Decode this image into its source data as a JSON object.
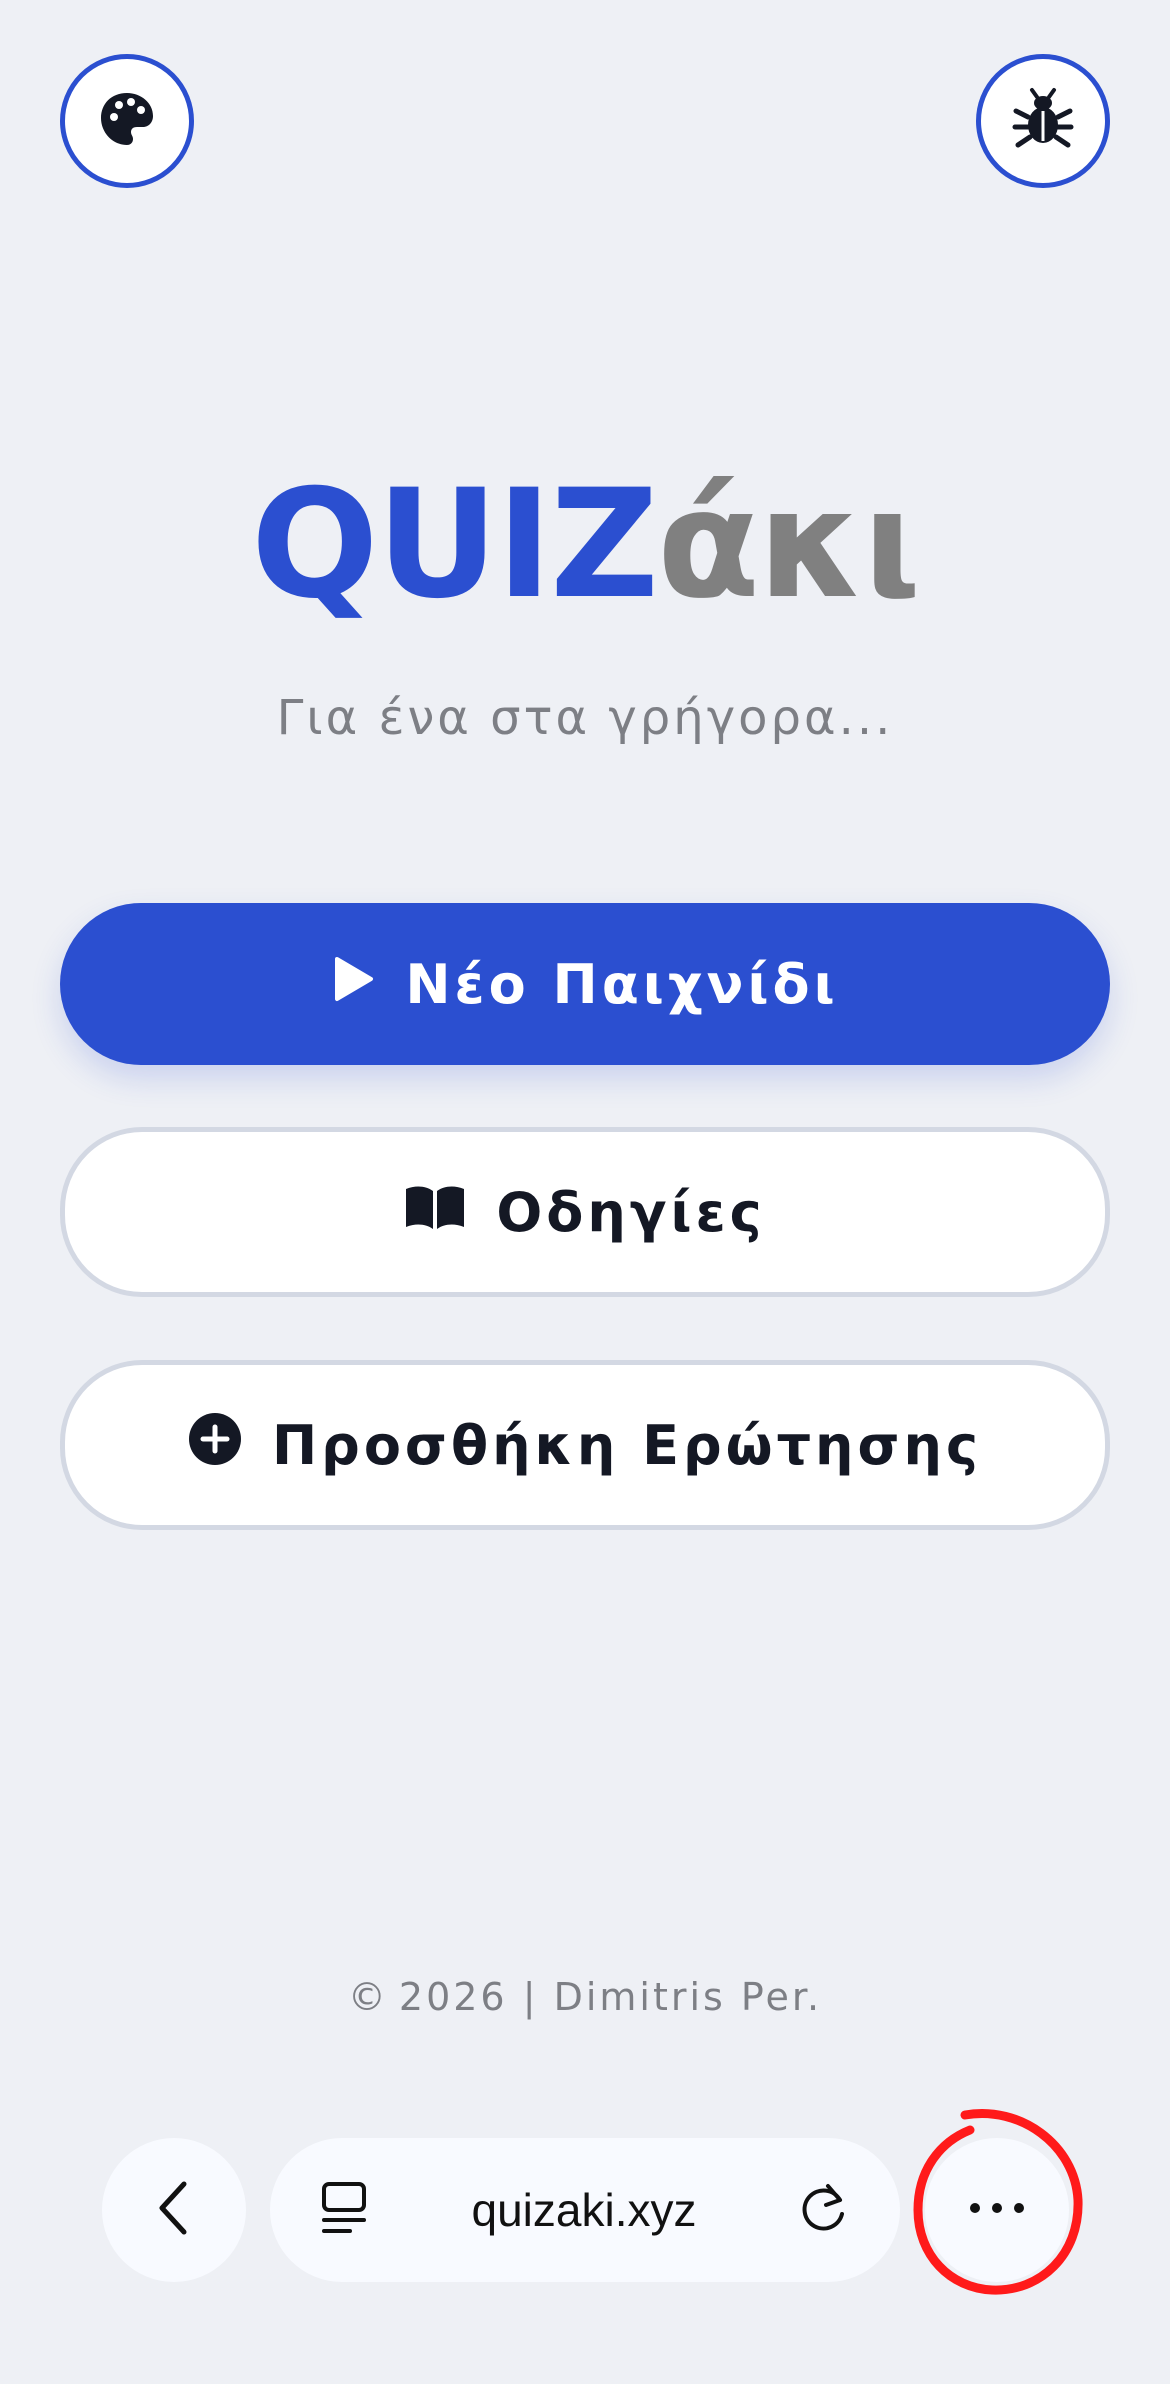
{
  "header": {
    "theme_icon": "palette-icon",
    "debug_icon": "bug-icon"
  },
  "logo": {
    "part1": "QUIZ",
    "part2": "άκι"
  },
  "subtitle": "Για ένα στα γρήγορα...",
  "buttons": {
    "new_game": "Νέο Παιχνίδι",
    "instructions": "Οδηγίες",
    "add_question": "Προσθήκη Ερώτησης"
  },
  "footer": {
    "symbol": "©",
    "text": "2026 | Dimitris Per."
  },
  "browser": {
    "url": "quizaki.xyz",
    "back_icon": "chevron-left-icon",
    "tab_icon": "tab-overview-icon",
    "reload_icon": "reload-icon",
    "more_icon": "more-horizontal-icon"
  },
  "colors": {
    "accent": "#2b4fd0",
    "background": "#eef0f5",
    "logo_gray": "#808080",
    "annotation": "#ff1a1a"
  }
}
